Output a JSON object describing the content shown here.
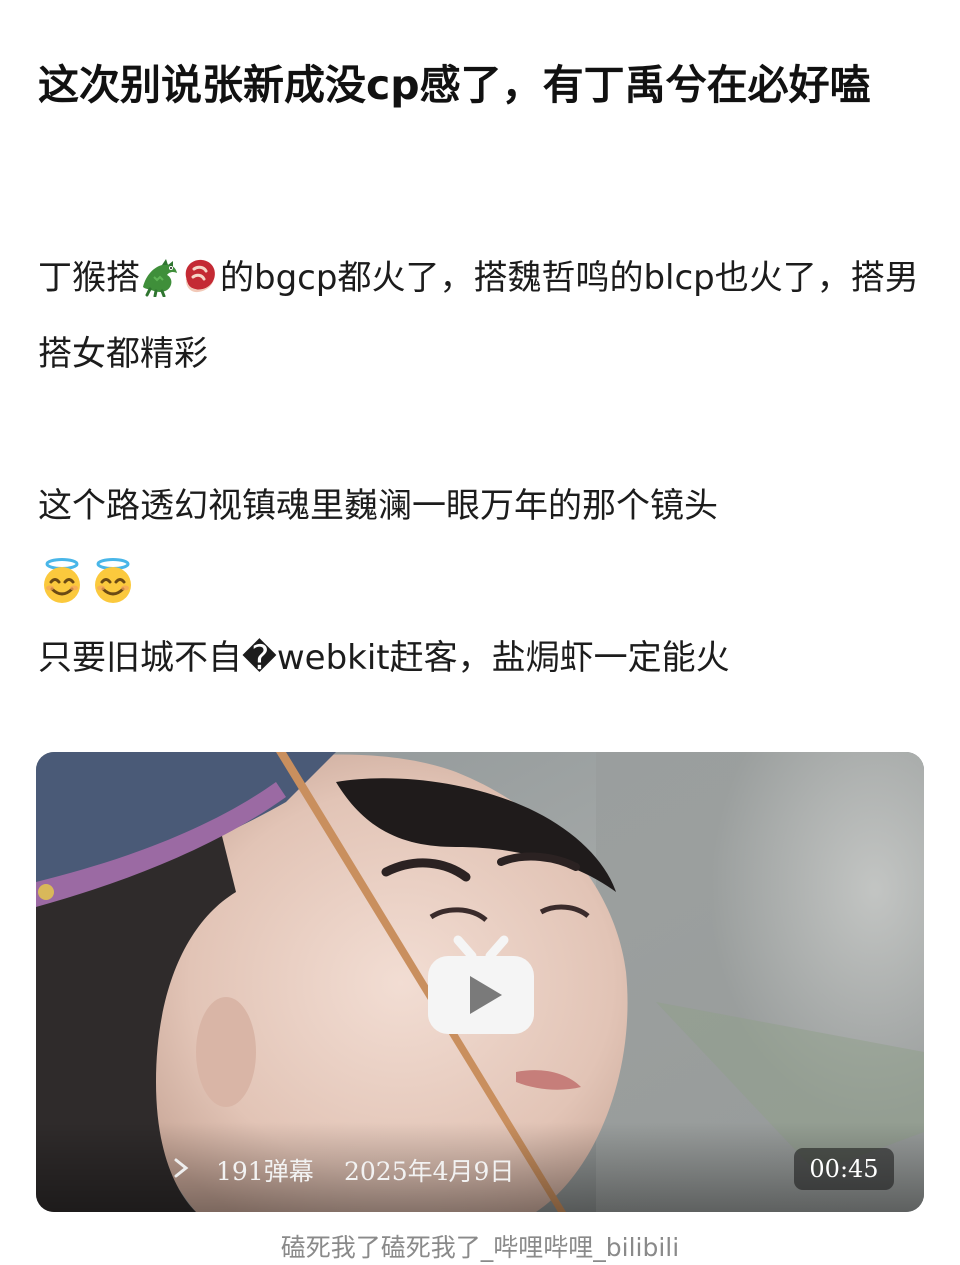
{
  "post": {
    "title": "这次别说张新成没cp感了，有丁禹兮在必好嗑",
    "body": {
      "line1_a": "丁猴搭",
      "line1_b": "的bgcp都火了，搭魏哲鸣的blcp也火了，搭男搭女都精彩",
      "line2": "这个路透幻视镇魂里巍澜一眼万年的那个镜头",
      "line3": "只要旧城不自�webkit赶客，盐焗虾一定能火"
    },
    "emoji_icons": [
      "crocodile-icon",
      "meat-icon",
      "smiling-face-with-halo-icon",
      "smiling-face-with-halo-icon"
    ]
  },
  "video": {
    "danmaku_count": "191弹幕",
    "publish_date": "2025年4月9日",
    "duration": "00:45",
    "play_icon": "bilibili-tv-play-icon",
    "caption": "磕死我了磕死我了_哔哩哔哩_bilibili"
  },
  "colors": {
    "title": "#111111",
    "body_text": "#1c1c1c",
    "caption": "#8a8a8a",
    "play_button_bg": "#f5f5f5",
    "play_button_glyph": "#7a7a7a"
  }
}
